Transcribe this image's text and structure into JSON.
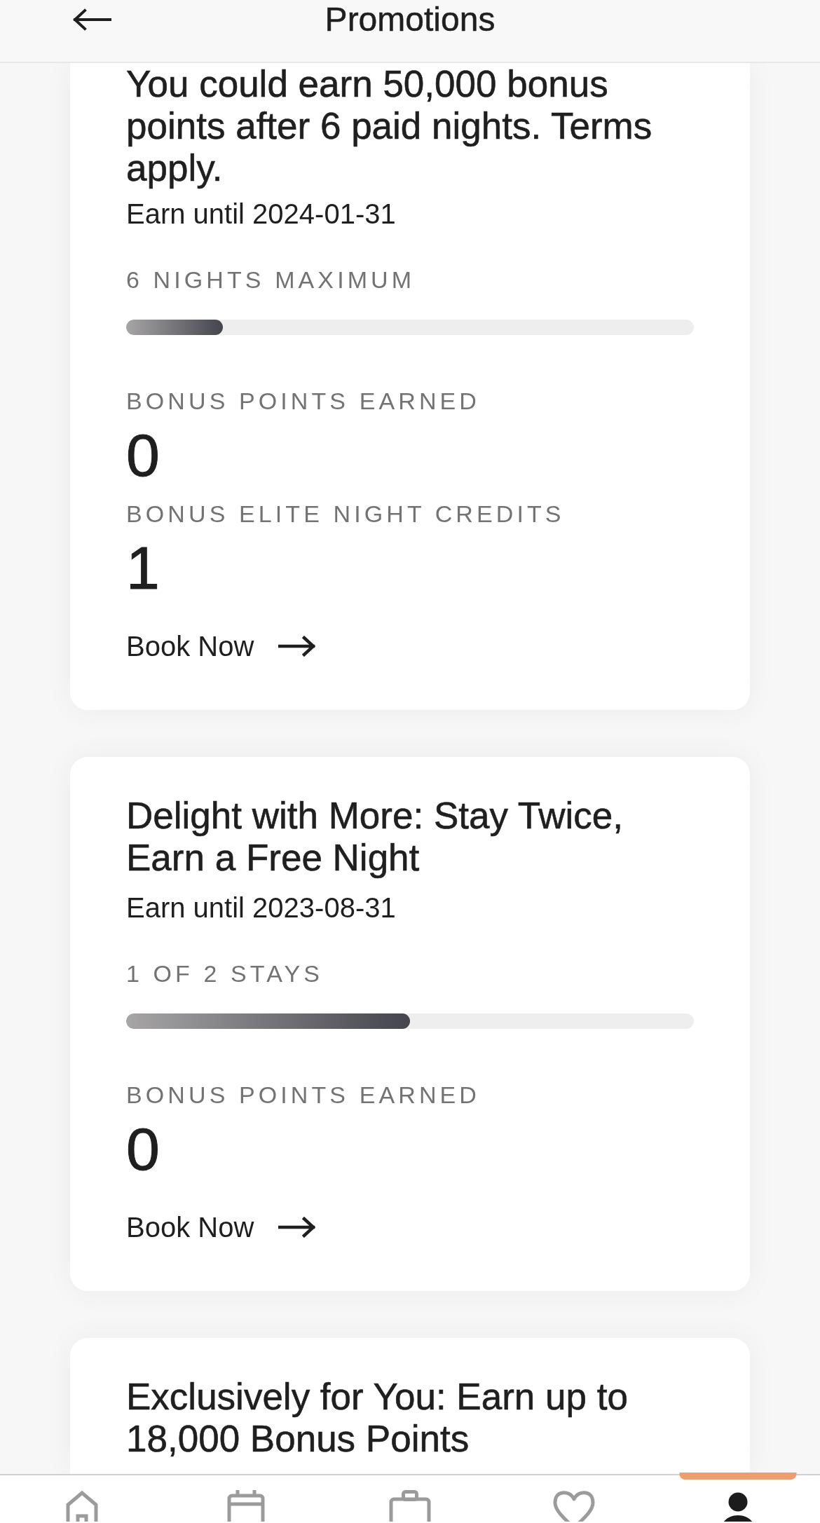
{
  "header": {
    "title": "Promotions"
  },
  "promotions": [
    {
      "title": "You could earn 50,000 bonus points after 6 paid nights. Terms apply.",
      "earn_until": "Earn until 2024-01-31",
      "progress": {
        "label": "6 NIGHTS MAXIMUM",
        "level": 0.17
      },
      "stats": [
        {
          "label": "BONUS POINTS EARNED",
          "value": "0"
        },
        {
          "label": "BONUS ELITE NIGHT CREDITS",
          "value": "1"
        }
      ],
      "link": "Book Now"
    },
    {
      "title": "Delight with More: Stay Twice, Earn a Free Night",
      "earn_until": "Earn until 2023-08-31",
      "progress": {
        "label": "1 OF 2 STAYS",
        "level": 0.5
      },
      "stats": [
        {
          "label": "BONUS POINTS EARNED",
          "value": "0"
        }
      ],
      "link": "Book Now"
    },
    {
      "title": "Exclusively for You: Earn up to 18,000 Bonus Points"
    }
  ],
  "bottom_nav": [
    {
      "kind": "home",
      "selected": false
    },
    {
      "kind": "calendar",
      "selected": false
    },
    {
      "kind": "suitcase",
      "selected": false
    },
    {
      "kind": "heart",
      "selected": false
    },
    {
      "kind": "person",
      "selected": true
    }
  ]
}
